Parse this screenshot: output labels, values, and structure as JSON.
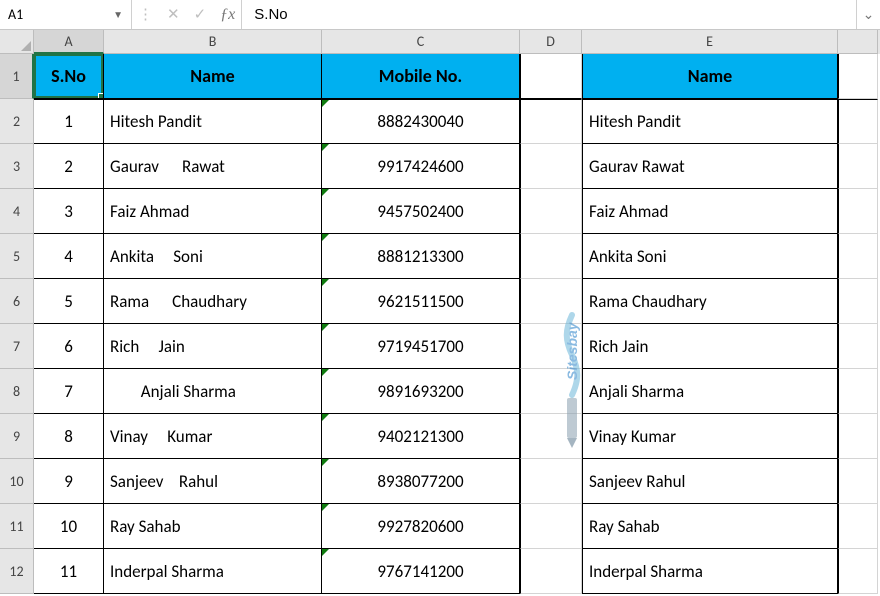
{
  "nameBox": "A1",
  "formulaBar": "S.No",
  "columns": [
    "A",
    "B",
    "C",
    "D",
    "E"
  ],
  "rowNumbers": [
    1,
    2,
    3,
    4,
    5,
    6,
    7,
    8,
    9,
    10,
    11,
    12
  ],
  "headers": {
    "A": "S.No",
    "B": "Name",
    "C": "Mobile No.",
    "E": "Name"
  },
  "rows": [
    {
      "sno": "1",
      "name": "Hitesh Pandit",
      "mobile": "8882430040",
      "clean": "Hitesh Pandit"
    },
    {
      "sno": "2",
      "name": "Gaurav      Rawat",
      "mobile": "9917424600",
      "clean": "Gaurav Rawat"
    },
    {
      "sno": "3",
      "name": "Faiz Ahmad",
      "mobile": "9457502400",
      "clean": "Faiz Ahmad"
    },
    {
      "sno": "4",
      "name": "Ankita     Soni",
      "mobile": "8881213300",
      "clean": "Ankita Soni"
    },
    {
      "sno": "5",
      "name": "Rama      Chaudhary",
      "mobile": "9621511500",
      "clean": "Rama Chaudhary"
    },
    {
      "sno": "6",
      "name": "Rich     Jain",
      "mobile": "9719451700",
      "clean": "Rich Jain"
    },
    {
      "sno": "7",
      "name": "        Anjali Sharma",
      "mobile": "9891693200",
      "clean": "Anjali Sharma"
    },
    {
      "sno": "8",
      "name": "Vinay     Kumar",
      "mobile": "9402121300",
      "clean": "Vinay Kumar"
    },
    {
      "sno": "9",
      "name": "Sanjeev    Rahul",
      "mobile": "8938077200",
      "clean": "Sanjeev Rahul"
    },
    {
      "sno": "10",
      "name": "Ray Sahab",
      "mobile": "9927820600",
      "clean": "Ray Sahab"
    },
    {
      "sno": "11",
      "name": "Inderpal Sharma",
      "mobile": "9767141200",
      "clean": "Inderpal Sharma"
    }
  ],
  "watermark": "Sitesbay"
}
